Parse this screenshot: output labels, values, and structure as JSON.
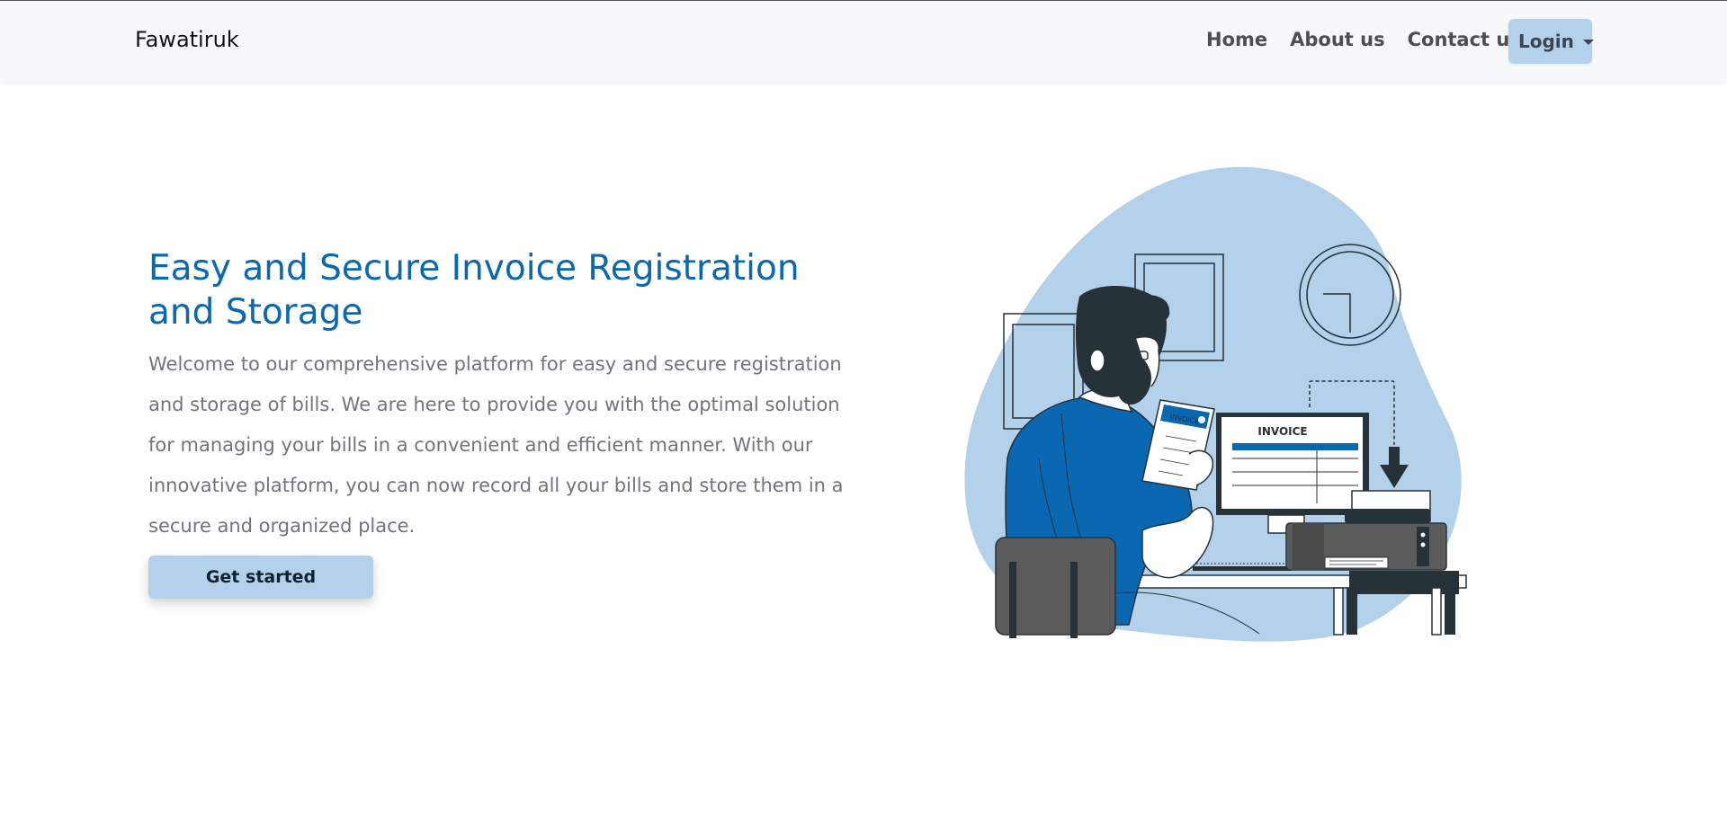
{
  "navbar": {
    "brand": "Fawatiruk",
    "links": [
      {
        "label": "Home"
      },
      {
        "label": "About us"
      },
      {
        "label": "Contact us"
      }
    ],
    "login_label": "Login"
  },
  "hero": {
    "title": "Easy and Secure Invoice Registration and Storage",
    "description": "Welcome to our comprehensive platform for easy and secure registration and storage of bills. We are here to provide you with the optimal solution for managing your bills in a convenient and efficient manner. With our innovative platform, you can now record all your bills and store them in a secure and organized place.",
    "cta_label": "Get started",
    "illustration": {
      "invoice_word": "INVOICE",
      "paper_invoice_word": "INVOICE"
    }
  },
  "colors": {
    "accent": "#0a67b2",
    "button_bg": "#b3d1ea",
    "blob": "#b3d1ea",
    "navbar_bg": "#f7f8fa",
    "dark": "#263238",
    "shirt": "#0a67b2"
  },
  "icons": {
    "login_caret": "caret-down-icon"
  }
}
